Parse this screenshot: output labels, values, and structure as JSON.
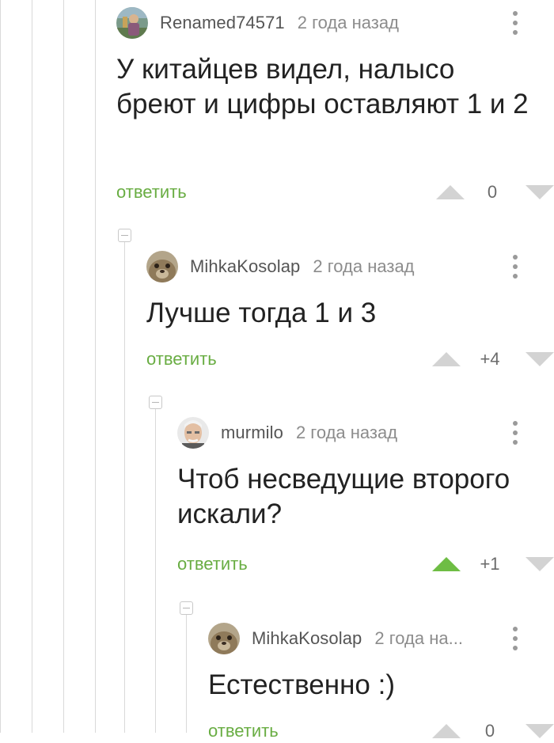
{
  "comments": [
    {
      "username": "Renamed74571",
      "avatar": "avatar-user-photo",
      "time": "2 года назад",
      "text": "У китайцев видел, налысо бреют и цифры оставляют 1 и 2",
      "reply_label": "ответить",
      "rating": "0",
      "upvoted": false
    },
    {
      "username": "MihkaKosolap",
      "avatar": "avatar-gopher",
      "time": "2 года назад",
      "text": "Лучше тогда 1 и 3",
      "reply_label": "ответить",
      "rating": "+4",
      "upvoted": false
    },
    {
      "username": "murmilo",
      "avatar": "avatar-old-man",
      "time": "2 года назад",
      "text": "Чтоб несведущие второго искали?",
      "reply_label": "ответить",
      "rating": "+1",
      "upvoted": true
    },
    {
      "username": "MihkaKosolap",
      "avatar": "avatar-gopher",
      "time": "2 года на...",
      "text": "Естественно :)",
      "reply_label": "ответить",
      "rating": "0",
      "upvoted": false
    }
  ],
  "colors": {
    "reply_link": "#69ad43",
    "upvote_active": "#6ebd44",
    "vote_inactive": "#d3d3d3",
    "thread_line": "#d9d9d9"
  }
}
